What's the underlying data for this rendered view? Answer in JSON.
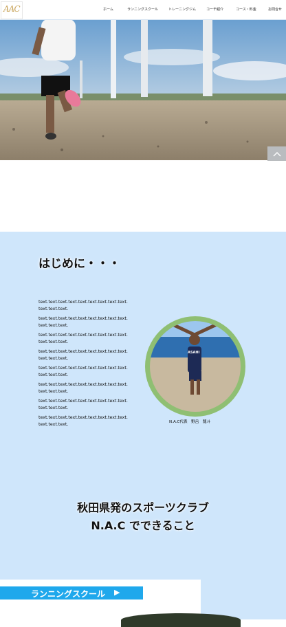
{
  "header": {
    "logo_text": "AAC",
    "nav": [
      "ホーム",
      "ランニングスクール",
      "トレーニングジム",
      "コーチ紹介",
      "コース・料金",
      "お問合せ"
    ]
  },
  "scroll_top": {
    "icon": "chevron-up-icon"
  },
  "intro": {
    "title": "はじめに・・・",
    "paragraphs": [
      "text.text.text.text.text.text.text.text.text.text.text.text.",
      "text.text.text.text.text.text.text.text.text.text.text.text.",
      "text.text.text.text.text.text.text.text.text.text.text.text.",
      "text.text.text.text.text.text.text.text.text.text.text.text.",
      "text.text.text.text.text.text.text.text.text.text.text.text.",
      "text.text.text.text.text.text.text.text.text.text.text.text.",
      "text.text.text.text.text.text.text.text.text.text.text.text.",
      "text.text.text.text.text.text.text.text.text.text.text.text."
    ],
    "photo_caption": "N.A.C代表　野呂　龍斗",
    "shirt_text": "ASAHI"
  },
  "about": {
    "line1": "秋田県発のスポーツクラブ",
    "line2": "N.A.C でできること"
  },
  "running_school": {
    "label": "ランニングスクール",
    "arrow": "▶"
  },
  "colors": {
    "section_bg": "#cfe6fb",
    "accent_blue": "#1fa8ec",
    "photo_ring": "#8fbf73"
  }
}
